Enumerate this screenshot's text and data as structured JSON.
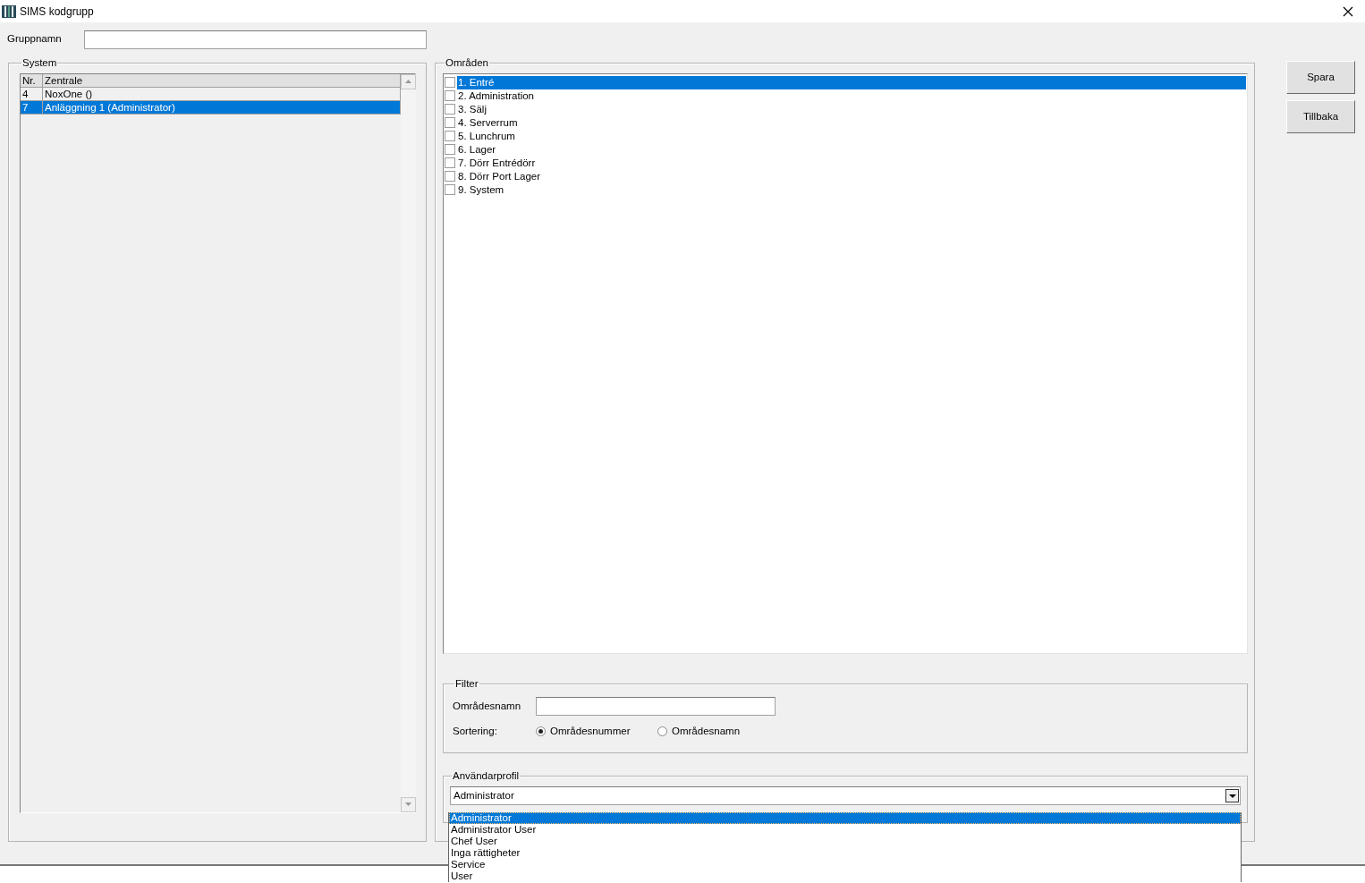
{
  "window": {
    "title": "SIMS kodgrupp"
  },
  "group_name": {
    "label": "Gruppnamn"
  },
  "system": {
    "title": "System",
    "columns": [
      "Nr.",
      "Zentrale"
    ],
    "rows": [
      {
        "cells": [
          "4",
          "NoxOne ()"
        ],
        "selected": false
      },
      {
        "cells": [
          "7",
          "Anläggning 1 (Administrator)"
        ],
        "selected": true
      }
    ]
  },
  "areas": {
    "title": "Områden",
    "items": [
      {
        "label": "1. Entré",
        "checked": false,
        "selected": true
      },
      {
        "label": "2. Administration",
        "checked": false,
        "selected": false
      },
      {
        "label": "3. Sälj",
        "checked": false,
        "selected": false
      },
      {
        "label": "4. Serverrum",
        "checked": false,
        "selected": false
      },
      {
        "label": "5. Lunchrum",
        "checked": false,
        "selected": false
      },
      {
        "label": "6. Lager",
        "checked": false,
        "selected": false
      },
      {
        "label": "7. Dörr Entrédörr",
        "checked": false,
        "selected": false
      },
      {
        "label": "8. Dörr Port Lager",
        "checked": false,
        "selected": false
      },
      {
        "label": "9. System",
        "checked": false,
        "selected": false
      }
    ]
  },
  "filter": {
    "title": "Filter",
    "name_label": "Områdesnamn",
    "sort_label": "Sortering:",
    "sort_options": [
      {
        "label": "Områdesnummer",
        "selected": true
      },
      {
        "label": "Områdesnamn",
        "selected": false
      }
    ]
  },
  "user_profile": {
    "title": "Användarprofil",
    "value": "Administrator",
    "options": [
      {
        "label": "Administrator",
        "selected": true
      },
      {
        "label": "Administrator User",
        "selected": false
      },
      {
        "label": "Chef User",
        "selected": false
      },
      {
        "label": "Inga rättigheter",
        "selected": false
      },
      {
        "label": "Service",
        "selected": false
      },
      {
        "label": "User",
        "selected": false
      }
    ]
  },
  "buttons": [
    "Spara",
    "Tillbaka"
  ]
}
